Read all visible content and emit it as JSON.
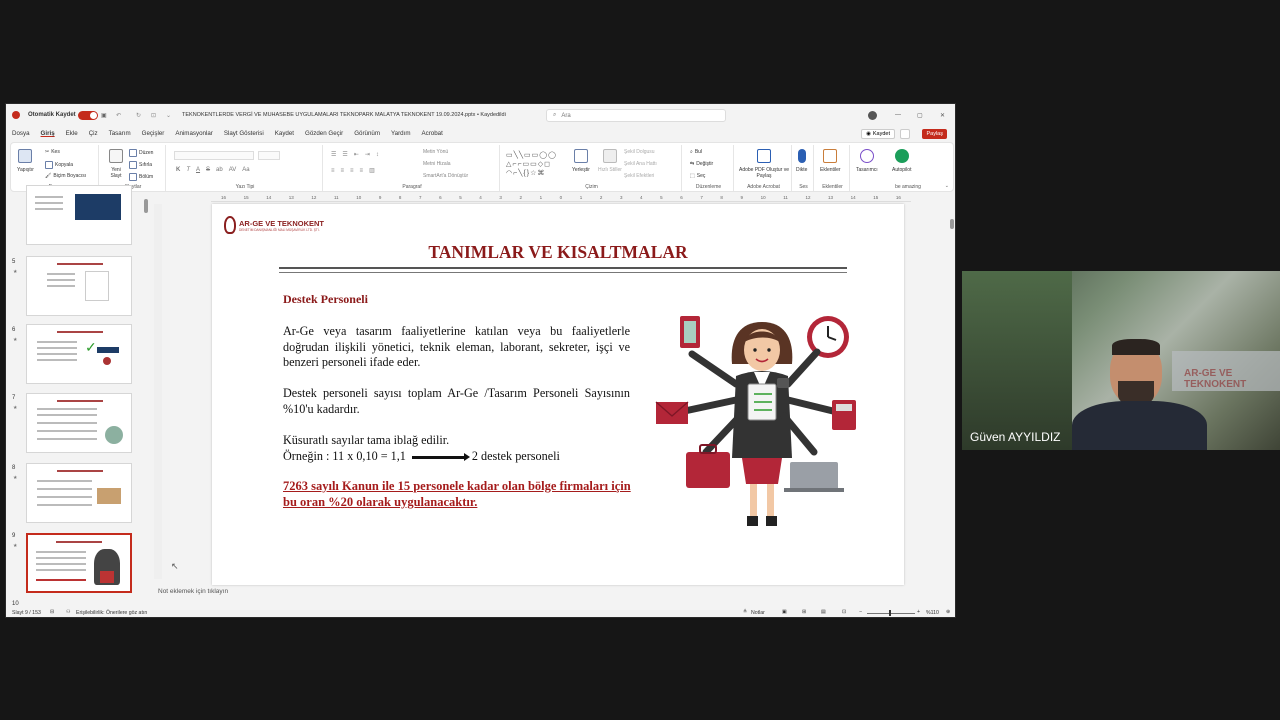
{
  "app": {
    "autosave_label": "Otomatik Kaydet",
    "file_title": "TEKNOKENTLERDE VERGİ VE MUHASEBE UYGULAMALARI TEKNOPARK MALATYA TEKNOKENT 19.09.2024.pptx • Kaydedildi",
    "search_placeholder": "Ara",
    "save_button": "Kaydet",
    "share_button": "Paylaş"
  },
  "menu": [
    "Dosya",
    "Giriş",
    "Ekle",
    "Çiz",
    "Tasarım",
    "Geçişler",
    "Animasyonlar",
    "Slayt Gösterisi",
    "Kaydet",
    "Gözden Geçir",
    "Görünüm",
    "Yardım",
    "Acrobat"
  ],
  "ribbon": {
    "pano": {
      "paste": "Yapıştır",
      "cut": "Kes",
      "copy": "Kopyala",
      "format": "Biçim Boyacısı",
      "label": "Pano"
    },
    "slaytlar": {
      "new": "Yeni Slayt",
      "layout": "Düzen",
      "reset": "Sıfırla",
      "section": "Bölüm",
      "label": "Slaytlar"
    },
    "yazi": {
      "label": "Yazı Tipi"
    },
    "paragraf": {
      "dir": "Metin Yönü",
      "align": "Metni Hizala",
      "smartart": "SmartArt'a Dönüştür",
      "label": "Paragraf"
    },
    "cizim": {
      "arrange": "Yerleştir",
      "styles": "Hızlı Stiller",
      "fill": "Şekil Dolgusu",
      "outline": "Şekil Ana Hattı",
      "effects": "Şekil Efektleri",
      "label": "Çizim"
    },
    "duzen": {
      "find": "Bul",
      "replace": "Değiştir",
      "select": "Seç",
      "label": "Düzenleme"
    },
    "acrobat": {
      "create": "Adobe PDF Oluştur ve Paylaş",
      "label": "Adobe Acrobat"
    },
    "ses": {
      "dictate": "Dikte",
      "label": "Ses"
    },
    "ekl": {
      "addins": "Eklentiler",
      "label": "Eklentiler"
    },
    "designer": {
      "label": "Tasarımcı"
    },
    "autopilot": {
      "label": "Autopilot",
      "sub": "be amazing"
    }
  },
  "ruler_ticks": [
    "16",
    "15",
    "14",
    "13",
    "12",
    "11",
    "10",
    "9",
    "8",
    "7",
    "6",
    "5",
    "4",
    "3",
    "2",
    "1",
    "0",
    "1",
    "2",
    "3",
    "4",
    "5",
    "6",
    "7",
    "8",
    "9",
    "10",
    "11",
    "12",
    "13",
    "14",
    "15",
    "16"
  ],
  "thumbnails": [
    {
      "num": "",
      "star": ""
    },
    {
      "num": "5",
      "star": "★"
    },
    {
      "num": "6",
      "star": "★"
    },
    {
      "num": "7",
      "star": "★"
    },
    {
      "num": "8",
      "star": "★"
    },
    {
      "num": "9",
      "star": "★"
    },
    {
      "num": "10",
      "star": ""
    }
  ],
  "slide": {
    "logo_title": "AR-GE VE TEKNOKENT",
    "logo_sub": "DENETİM DANIŞMANLIĞI MALİ MÜŞAVİRLİK LTD. ŞTİ.",
    "title": "TANIMLAR VE KISALTMALAR",
    "subtitle": "Destek Personeli",
    "p1": "Ar-Ge veya tasarım faaliyetlerine katılan veya bu faaliyetlerle doğrudan ilişkili yönetici, teknik eleman, laborant, sekreter, işçi ve benzeri personeli ifade eder.",
    "p2": "Destek personeli sayısı toplam Ar-Ge /Tasarım Personeli Sayısının %10'u kadardır.",
    "p3a": "Küsuratlı sayılar tama iblağ edilir.",
    "p3b_left": "Örneğin : 11 x 0,10 = 1,1",
    "p3b_right": "2 destek personeli",
    "warning": "7263 sayılı Kanun ile 15 personele kadar olan bölge firmaları için bu oran %20 olarak uygulanacaktır."
  },
  "notes_placeholder": "Not eklemek için tıklayın",
  "status": {
    "slide_counter": "Slayt 9 / 153",
    "accessibility": "Erişilebilirlik: Önerilere göz atın",
    "notes": "Notlar",
    "zoom": "%110"
  },
  "video": {
    "name": "Güven AYYILDIZ"
  },
  "colors": {
    "accent": "#c42b1c",
    "title_red": "#8b1a1a",
    "warn_red": "#a51c1c"
  }
}
